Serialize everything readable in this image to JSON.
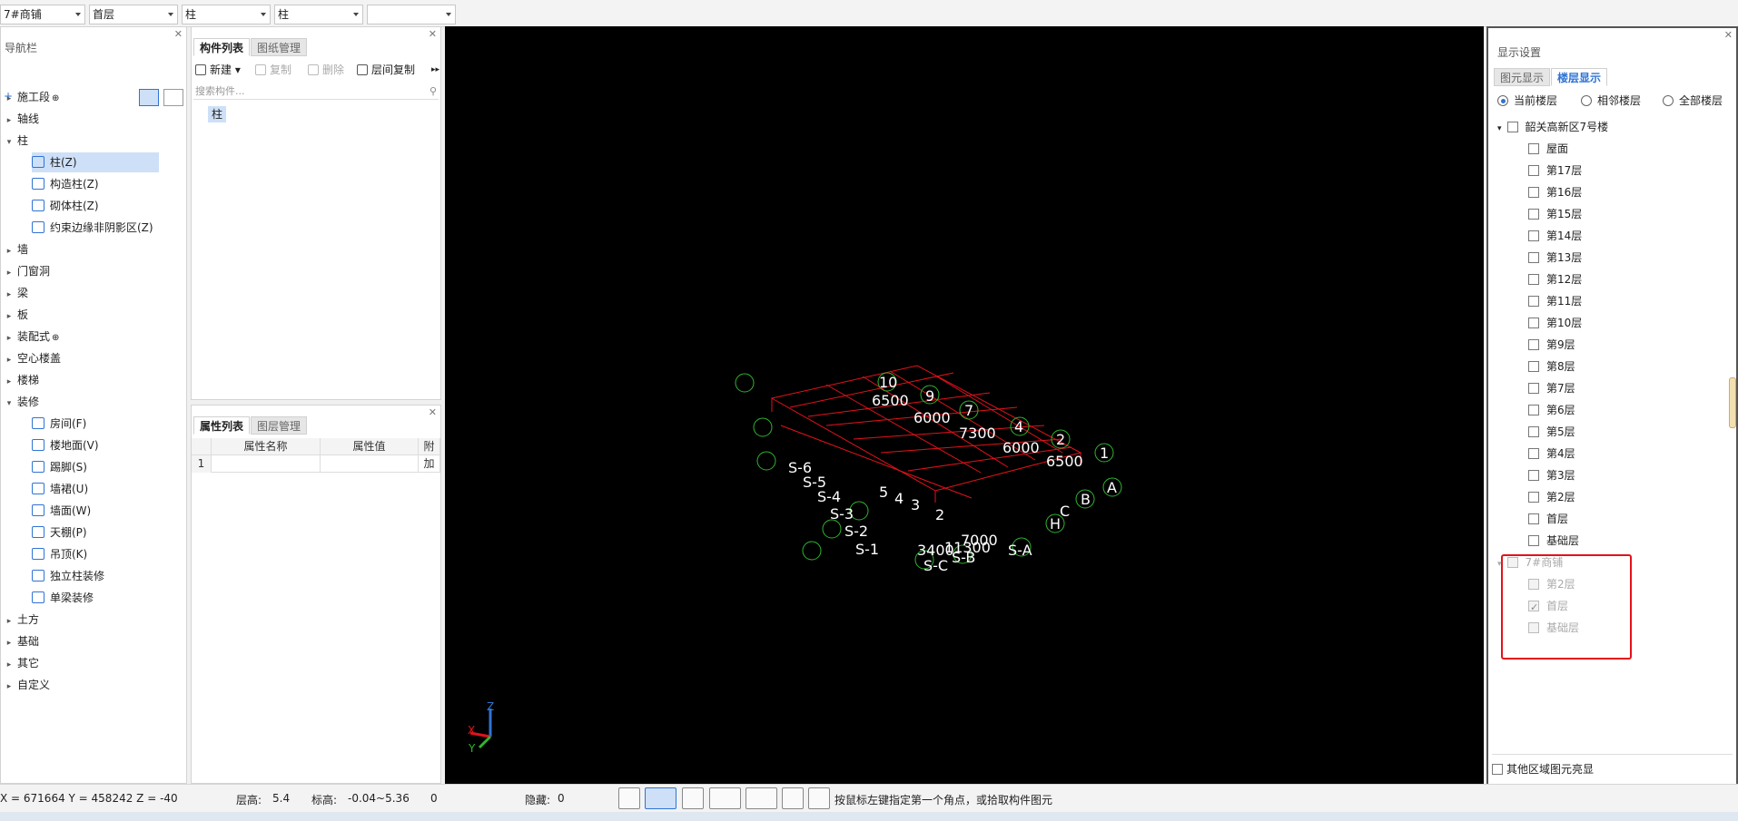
{
  "topbar": {
    "combos": [
      "7#商铺",
      "首层",
      "柱",
      "柱",
      ""
    ]
  },
  "nav": {
    "title": "导航栏",
    "groups": [
      {
        "label": "施工段",
        "icon": "lock-icon"
      },
      {
        "label": "轴线"
      },
      {
        "label": "柱",
        "expanded": true
      },
      {
        "label": "墙"
      },
      {
        "label": "门窗洞"
      },
      {
        "label": "梁"
      },
      {
        "label": "板"
      },
      {
        "label": "装配式",
        "icon": "lock-icon"
      },
      {
        "label": "空心楼盖"
      },
      {
        "label": "楼梯"
      },
      {
        "label": "装修",
        "expanded": true
      },
      {
        "label": "土方"
      },
      {
        "label": "基础"
      },
      {
        "label": "其它"
      },
      {
        "label": "自定义"
      }
    ],
    "column_items": [
      "柱(Z)",
      "构造柱(Z)",
      "砌体柱(Z)",
      "约束边缘非阴影区(Z)"
    ],
    "decoration_items": [
      "房间(F)",
      "楼地面(V)",
      "踢脚(S)",
      "墙裙(U)",
      "墙面(W)",
      "天棚(P)",
      "吊顶(K)",
      "独立柱装修",
      "单梁装修"
    ]
  },
  "complist": {
    "tabs": [
      "构件列表",
      "图纸管理"
    ],
    "toolbar": {
      "new": "新建",
      "copy": "复制",
      "delete": "删除",
      "floor_copy": "层间复制"
    },
    "search_placeholder": "搜索构件...",
    "items": [
      "柱"
    ]
  },
  "proplist": {
    "tabs": [
      "属性列表",
      "图层管理"
    ],
    "columns": [
      "属性名称",
      "属性值",
      "附加"
    ],
    "rows": [
      {
        "index": "1",
        "name": "",
        "value": "",
        "extra": ""
      }
    ]
  },
  "viewport": {
    "axis_labels": [
      "X",
      "Y",
      "Z"
    ],
    "grid_labels": [
      "10",
      "9",
      "7",
      "4",
      "2",
      "1",
      "A",
      "B",
      "C",
      "H",
      "S-A",
      "S-B",
      "S-C",
      "S-1",
      "S-2",
      "S-3",
      "S-4",
      "S-5",
      "S-6",
      "2",
      "3",
      "4",
      "5",
      "6500",
      "6000",
      "7300",
      "6000",
      "6500",
      "3400",
      "7000",
      "11300"
    ],
    "line_color": "#e3121b",
    "label_color": "#2fb52f"
  },
  "display": {
    "title": "显示设置",
    "tabs": [
      "图元显示",
      "楼层显示"
    ],
    "radios": [
      {
        "label": "当前楼层",
        "checked": true
      },
      {
        "label": "相邻楼层",
        "checked": false
      },
      {
        "label": "全部楼层",
        "checked": false
      }
    ],
    "building1": {
      "name": "韶关高新区7号楼",
      "floors": [
        "屋面",
        "第17层",
        "第16层",
        "第15层",
        "第14层",
        "第13层",
        "第12层",
        "第11层",
        "第10层",
        "第9层",
        "第8层",
        "第7层",
        "第6层",
        "第5层",
        "第4层",
        "第3层",
        "第2层",
        "首层",
        "基础层"
      ]
    },
    "building2": {
      "name": "7#商铺",
      "floors": [
        {
          "label": "第2层",
          "checked": false
        },
        {
          "label": "首层",
          "checked": true
        },
        {
          "label": "基础层",
          "checked": false
        }
      ]
    },
    "other_highlight": "其他区域图元亮显"
  },
  "status": {
    "coords": "X = 671664 Y = 458242 Z = -40",
    "floor_height_label": "层高:",
    "floor_height": "5.4",
    "elevation_label": "标高:",
    "elevation": "-0.04~5.36",
    "zero": "0",
    "hidden_label": "隐藏:",
    "hidden": "0",
    "hint": "按鼠标左键指定第一个角点，或拾取构件图元"
  }
}
